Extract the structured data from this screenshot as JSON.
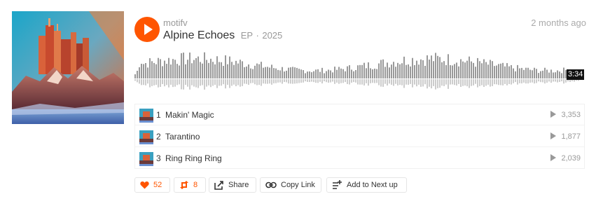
{
  "track": {
    "artist": "motifv",
    "title": "Alpine Echoes",
    "type": "EP",
    "separator": "·",
    "year": "2025",
    "posted": "2 months ago",
    "duration": "3:34"
  },
  "colors": {
    "accent": "#ff5500",
    "wave": "#999999",
    "wave_reflection": "#cccccc"
  },
  "tracklist": [
    {
      "num": "1",
      "name": "Makin' Magic",
      "plays": "3,353"
    },
    {
      "num": "2",
      "name": "Tarantino",
      "plays": "1,877"
    },
    {
      "num": "3",
      "name": "Ring Ring Ring",
      "plays": "2,039"
    }
  ],
  "actions": {
    "like": {
      "icon": "heart-icon",
      "count": "52"
    },
    "repost": {
      "icon": "repost-icon",
      "count": "8"
    },
    "share": {
      "icon": "share-icon",
      "label": "Share"
    },
    "copy_link": {
      "icon": "link-icon",
      "label": "Copy Link"
    },
    "next_up": {
      "icon": "add-to-queue-icon",
      "label": "Add to Next up"
    }
  }
}
